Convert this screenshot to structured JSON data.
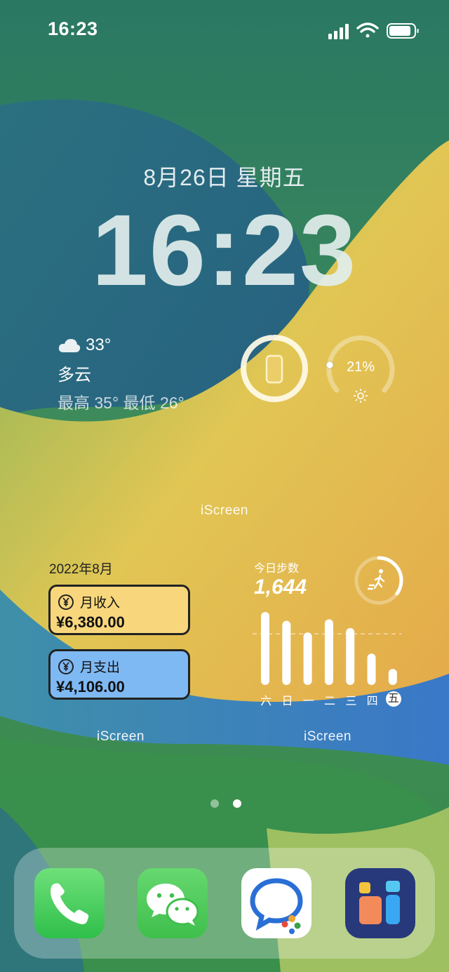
{
  "status_bar": {
    "time": "16:23"
  },
  "lock": {
    "date": "8月26日 星期五",
    "time": "16:23"
  },
  "weather": {
    "temp": "33°",
    "condition": "多云",
    "range": "最高 35° 最低 26°"
  },
  "battery_ring": {
    "icon": "phone-icon",
    "level": 0.98
  },
  "brightness_ring": {
    "percent": "21%",
    "value": 0.21,
    "icon": "sun-icon"
  },
  "widget_labels": {
    "top": "iScreen",
    "left": "iScreen",
    "right": "iScreen"
  },
  "finance": {
    "month": "2022年8月",
    "income": {
      "label": "月收入",
      "amount": "¥6,380.00",
      "color": "#f8d77c"
    },
    "expense": {
      "label": "月支出",
      "amount": "¥4,106.00",
      "color": "#7fb9f4"
    }
  },
  "steps": {
    "label": "今日步数",
    "value": "1,644",
    "days": [
      "六",
      "日",
      "一",
      "二",
      "三",
      "四",
      "五"
    ],
    "bars": [
      1.0,
      0.88,
      0.72,
      0.9,
      0.78,
      0.43,
      0.22
    ],
    "average_line": 0.7,
    "ring_progress": 0.35
  },
  "page_dots": {
    "count": 2,
    "active": 1
  },
  "dock": {
    "apps": [
      {
        "name": "Phone",
        "icon": "phone-app-icon"
      },
      {
        "name": "WeChat",
        "icon": "wechat-app-icon"
      },
      {
        "name": "DingTalk",
        "icon": "chat-app-icon"
      },
      {
        "name": "iScreen",
        "icon": "iscreen-app-icon"
      }
    ]
  }
}
